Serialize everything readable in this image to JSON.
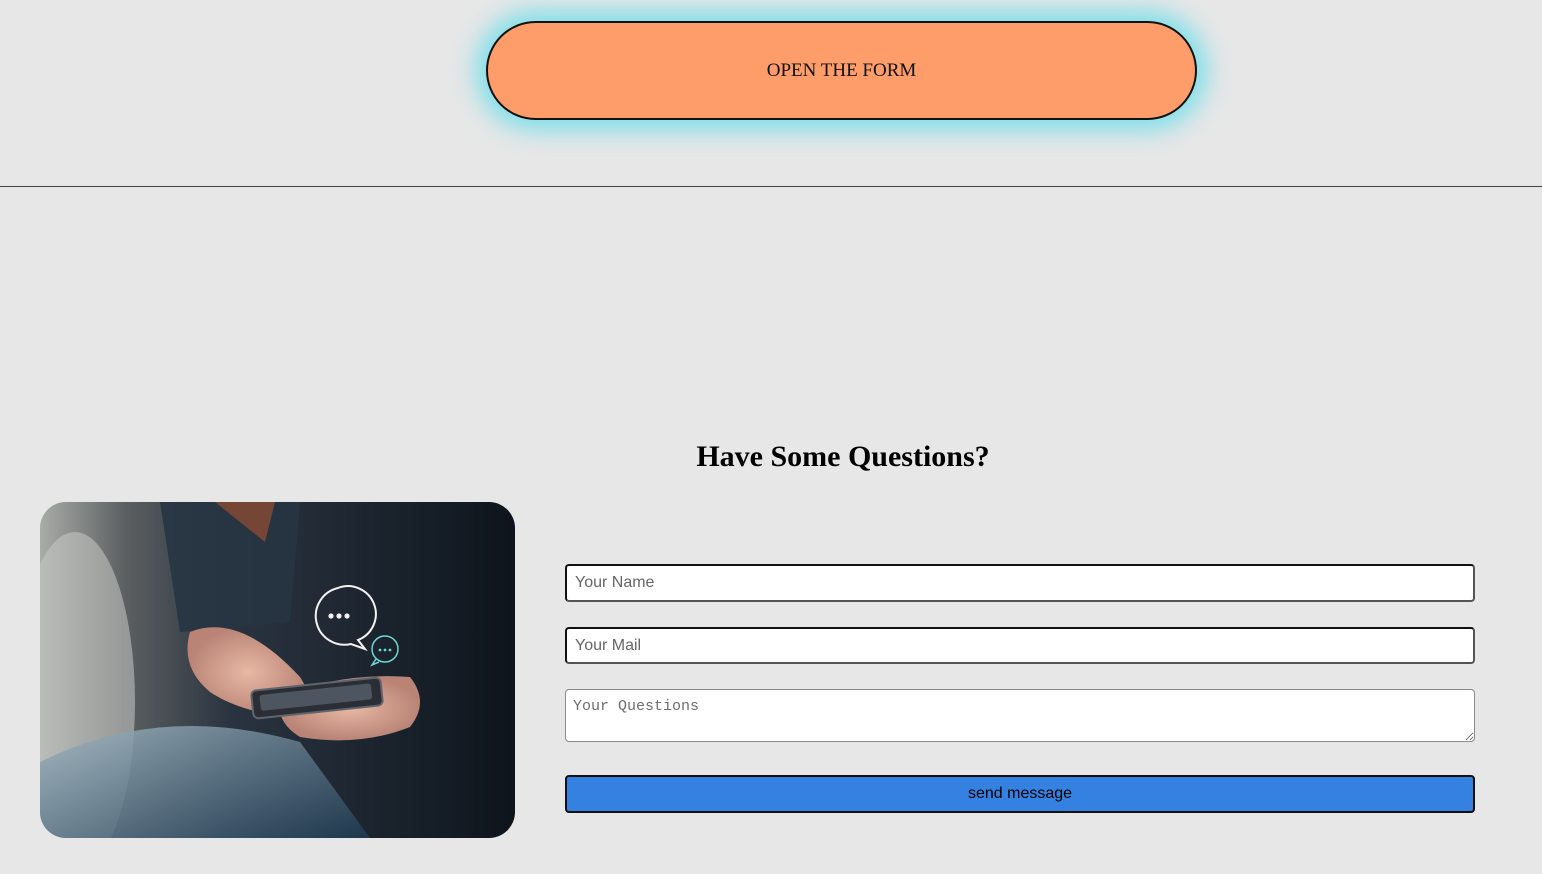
{
  "header": {
    "open_button_label": "OPEN THE FORM"
  },
  "contact": {
    "heading": "Have Some Questions?",
    "name_placeholder": "Your Name",
    "mail_placeholder": "Your Mail",
    "questions_placeholder": "Your Questions",
    "send_label": "send message"
  },
  "colors": {
    "background": "#e7e7e7",
    "open_button": "#ff9d6a",
    "open_button_glow": "#5adceb",
    "send_button": "#3581e2"
  }
}
